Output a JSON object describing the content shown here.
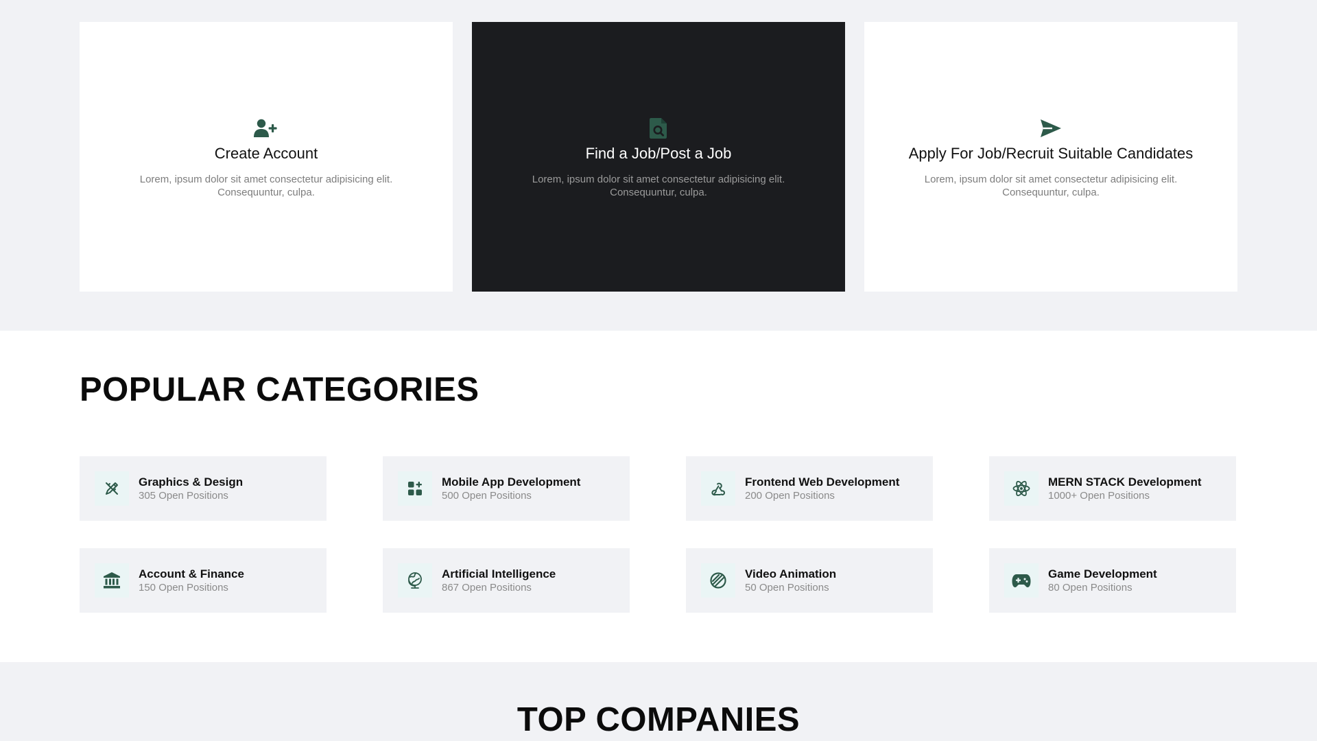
{
  "how_it_works": {
    "cards": [
      {
        "icon": "user-plus-icon",
        "title": "Create Account",
        "description": "Lorem, ipsum dolor sit amet consectetur adipisicing elit. Consequuntur, culpa."
      },
      {
        "icon": "file-search-icon",
        "title": "Find a Job/Post a Job",
        "description": "Lorem, ipsum dolor sit amet consectetur adipisicing elit. Consequuntur, culpa."
      },
      {
        "icon": "send-icon",
        "title": "Apply For Job/Recruit Suitable Candidates",
        "description": "Lorem, ipsum dolor sit amet consectetur adipisicing elit. Consequuntur, culpa."
      }
    ]
  },
  "popular_categories": {
    "heading": "POPULAR CATEGORIES",
    "items": [
      {
        "icon": "pencil-ruler-icon",
        "name": "Graphics & Design",
        "count": "305 Open Positions"
      },
      {
        "icon": "app-grid-add-icon",
        "name": "Mobile App Development",
        "count": "500 Open Positions"
      },
      {
        "icon": "webhook-icon",
        "name": "Frontend Web Development",
        "count": "200 Open Positions"
      },
      {
        "icon": "react-atom-icon",
        "name": "MERN STACK Development",
        "count": "1000+ Open Positions"
      },
      {
        "icon": "bank-icon",
        "name": "Account & Finance",
        "count": "150 Open Positions"
      },
      {
        "icon": "brain-globe-icon",
        "name": "Artificial Intelligence",
        "count": "867 Open Positions"
      },
      {
        "icon": "film-reel-icon",
        "name": "Video Animation",
        "count": "50 Open Positions"
      },
      {
        "icon": "gamepad-icon",
        "name": "Game Development",
        "count": "80 Open Positions"
      }
    ]
  },
  "top_companies": {
    "heading": "TOP COMPANIES"
  },
  "colors": {
    "accent": "#2d5a4a",
    "page_bg": "#f1f2f5",
    "dark_card": "#1b1c1f",
    "icon_tile": "#eaf5f5"
  }
}
